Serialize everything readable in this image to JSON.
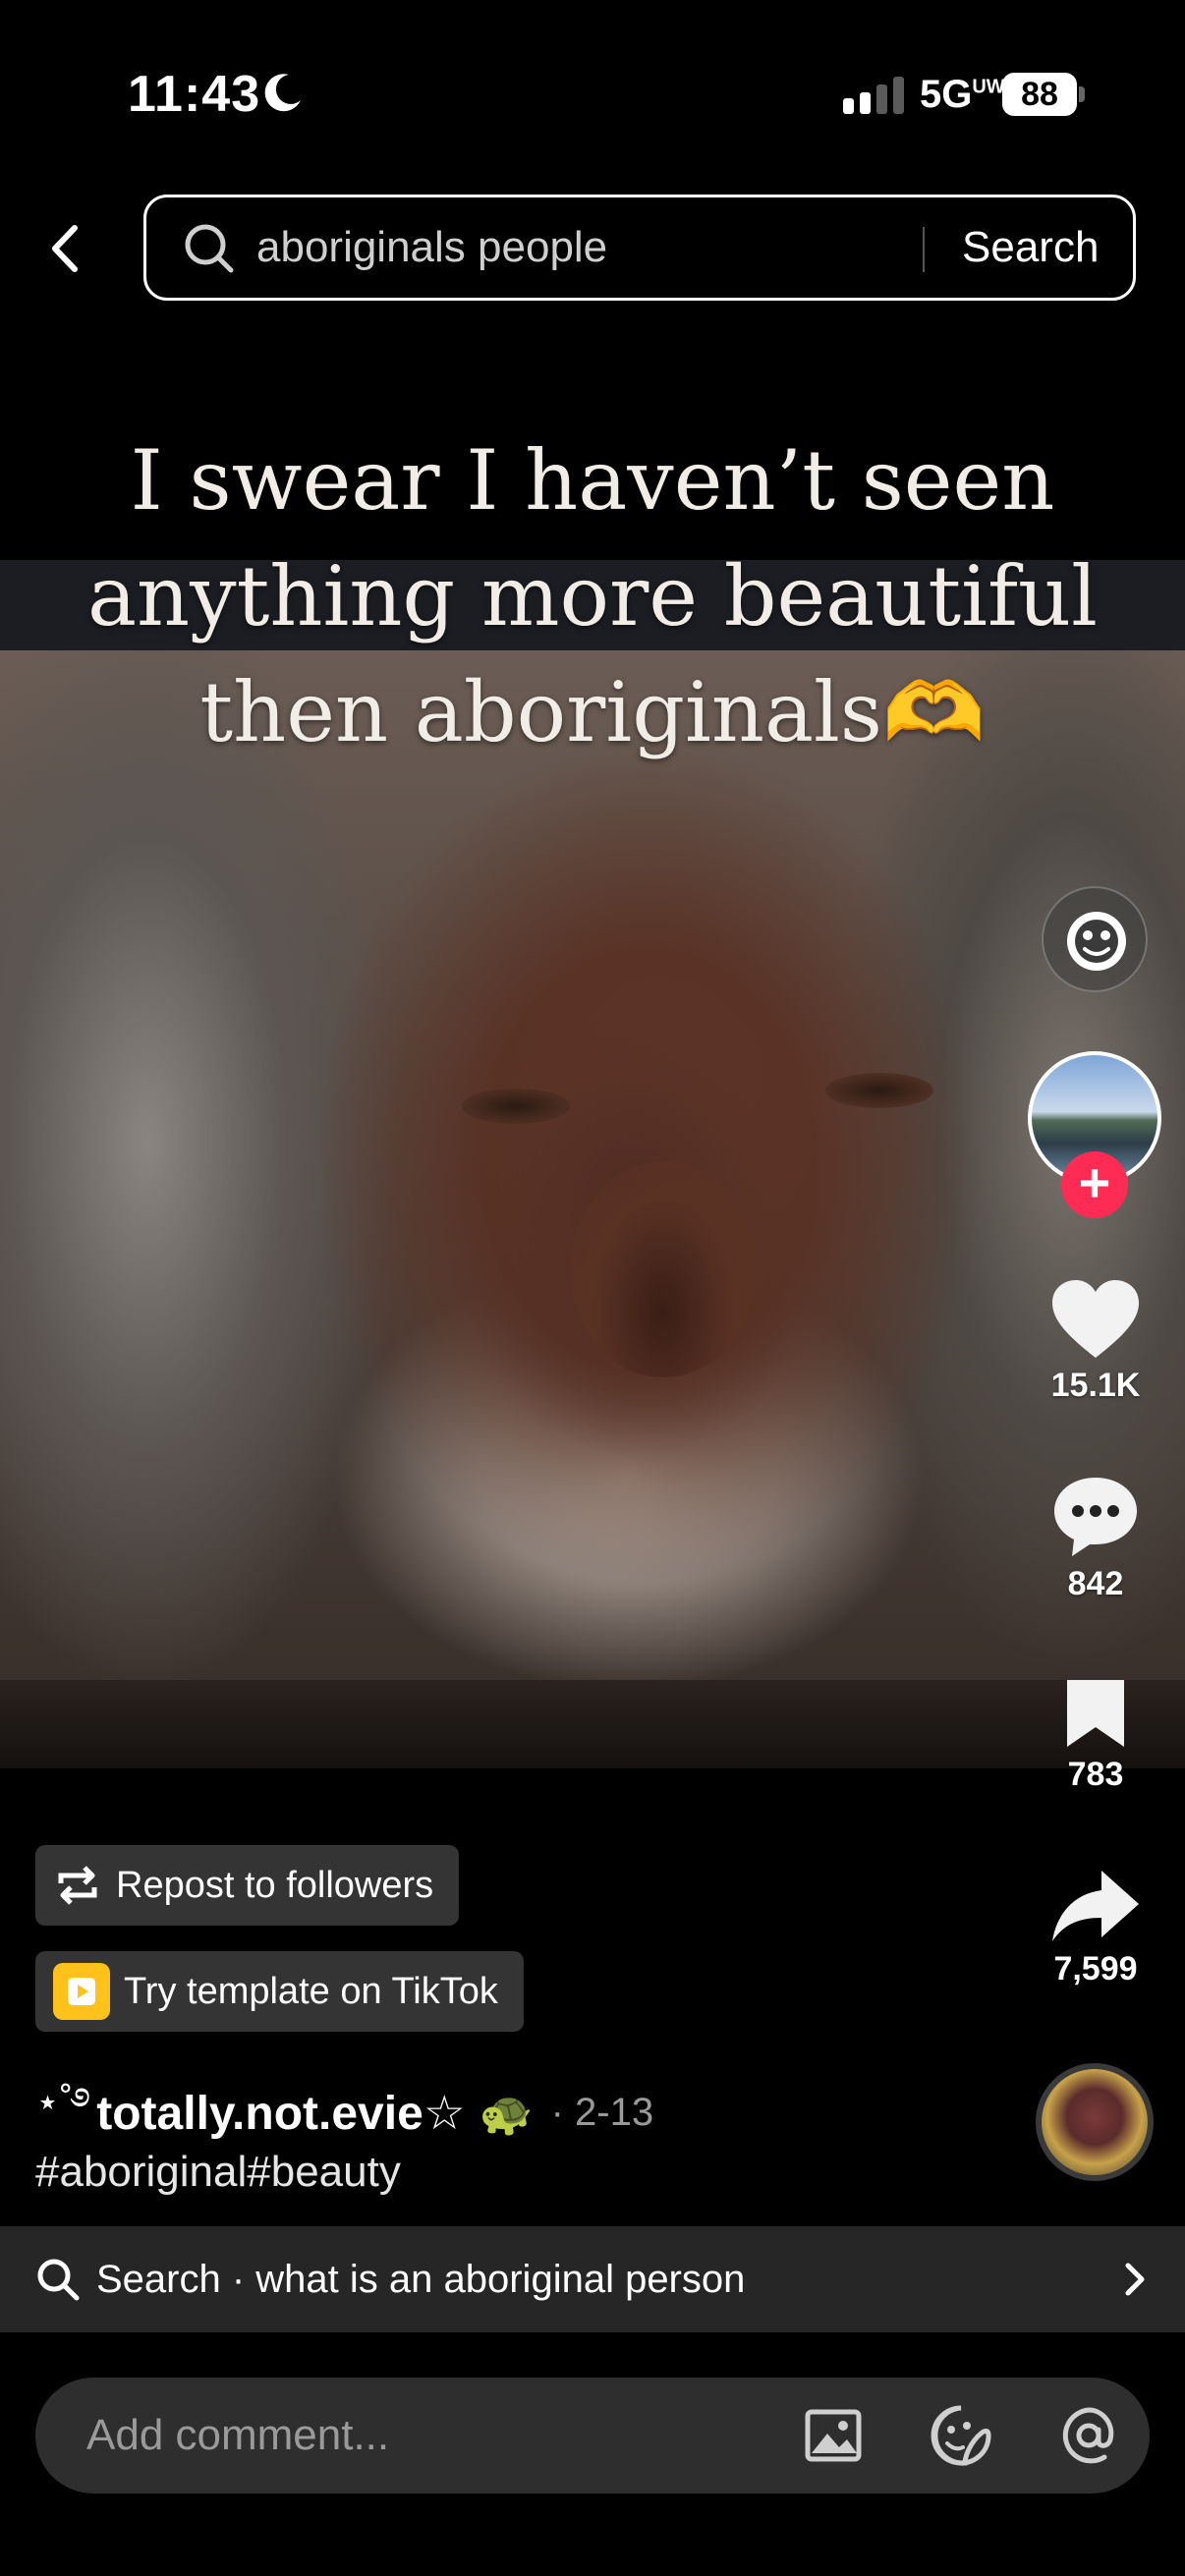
{
  "status_bar": {
    "time": "11:43",
    "network": "5G",
    "network_sup": "UW",
    "battery": "88",
    "icons": [
      "moon-icon",
      "signal-icon",
      "battery-icon"
    ]
  },
  "search": {
    "query": "aboriginals people",
    "button_label": "Search"
  },
  "video": {
    "caption_lines": [
      "I swear I haven’t seen",
      "anything more beautiful",
      "then aboriginals"
    ],
    "caption_emoji": "🫶"
  },
  "actions": {
    "likes": "15.1K",
    "comments": "842",
    "saves": "783",
    "shares": "7,599",
    "follow_label": "+"
  },
  "info": {
    "repost_label": "Repost to followers",
    "template_label": "Try template on TikTok",
    "author_deco": "⋆˚࿔",
    "author": "totally.not.evie☆",
    "author_suffix_emoji": "🐢",
    "date": "· 2-13",
    "hashtags": "#aboriginal#beauty"
  },
  "suggestion": {
    "label": "Search · what is an aboriginal person"
  },
  "comment": {
    "placeholder": "Add comment..."
  },
  "colors": {
    "accent": "#fe2c55",
    "template_icon": "#ffc21a",
    "background": "#000000"
  }
}
